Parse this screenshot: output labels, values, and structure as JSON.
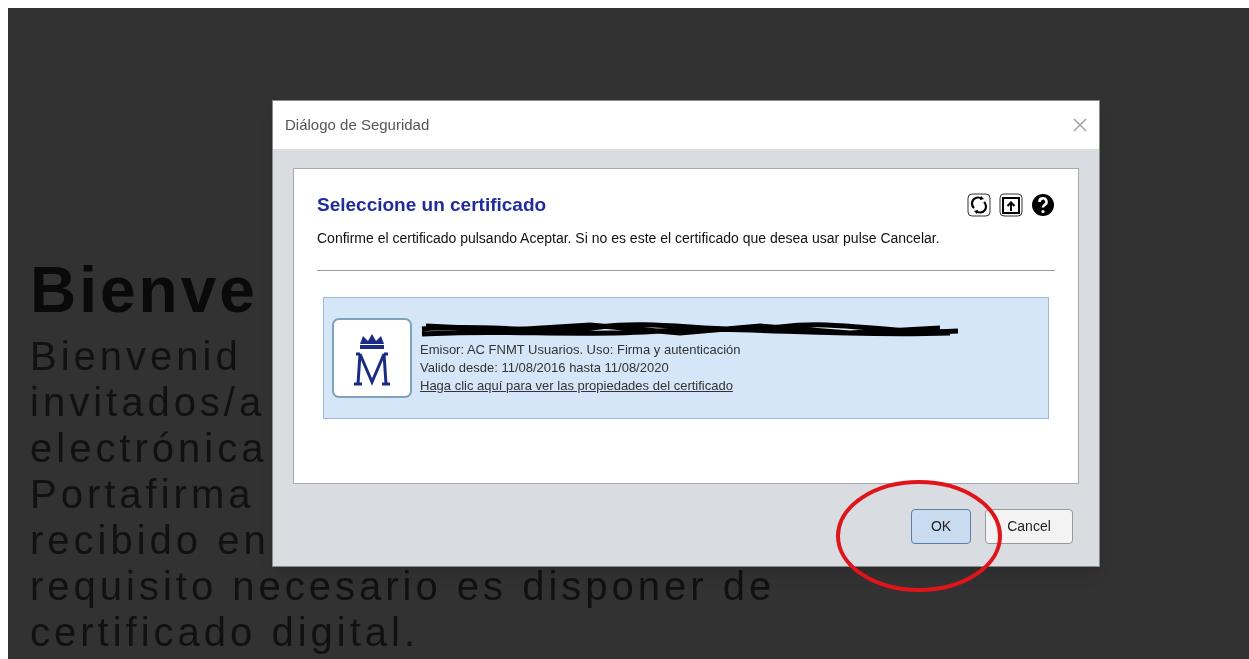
{
  "page": {
    "heading": "Bienve",
    "lines": [
      "Bienvenid",
      "invitados/a",
      "electrónica",
      "Portafirma",
      "recibido en",
      "requisito necesario es disponer de",
      "certificado digital."
    ]
  },
  "dialog": {
    "title": "Diálogo de Seguridad",
    "heading": "Seleccione un certificado",
    "message": "Confirme el certificado pulsando Aceptar. Si no es este el certificado que desea usar pulse Cancelar.",
    "certificate": {
      "issuer": "Emisor: AC FNMT Usuarios. Uso: Firma y autenticación",
      "validity": "Valido desde: 11/08/2016 hasta 11/08/2020",
      "link": "Haga clic aquí para ver las propiedades del certificado",
      "selected": true
    },
    "buttons": [
      {
        "label": "OK",
        "kind": "primary"
      },
      {
        "label": "Cancel",
        "kind": "secondary"
      }
    ]
  }
}
